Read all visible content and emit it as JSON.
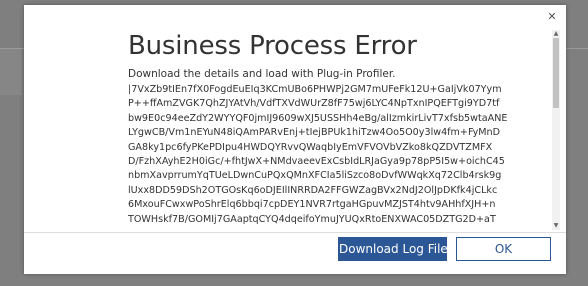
{
  "dialog": {
    "title": "Business Process Error",
    "subtitle": "Download the details and load with Plug-in Profiler.",
    "close_glyph": "✕",
    "log_lines": [
      "|7VxZb9tIEn7fX0FogdEuEIq3KCmUBo6PHWPj2GM7mUFeFk12U+GaIjVk07Yym",
      "P++ffAmZVGK7QhZJYAtVh/VdfTXVdWUrZ8fF75wj6LYC4NpTxnIPQEFTgi9YD7tf",
      "bw9E0c94eeZdY2WYYQF0jmIJ9609wXJ5USSHh4eBg/alIzmkirLivT7xfsb5wtaANE",
      "LYgwCB/Vm1nEYuN48iQAmPARvEnj+tIejBPUk1hiTzw4Oo5O0y3lw4fm+FyMnD",
      "GA8ky1pc6fyPKePDIpu4HWDQYRvvQWaqbIyEmVFVOVbVZko8kQZDVTZMFX",
      "D/FzhXAyhE2H0iGc/+fhtJwX+NMdvaeevExCsbIdLRJaGya9p78pP5I5w+oichC45",
      "nbmXavprrumYqTUeLDwnCuPQxQMnXFCIa5liSzco8oDvfWWqkXq72Clb4rsk9g",
      "lUxx8DD59DSh2OTGOsKq6oDJEIlINRRDA2FFGWZagBVx2NdJ2OlJpDKfk4jCLkc",
      "6MxouFCwxwPoShrElq6bbqi7cpDEY1NVR7rtgaHGpuvMZJST4htv9AHhfXJH+n",
      "TOWHskf7B/GOMIj7GAaptqCYQ4dqeifoYmuJYUQxRtoENXWAC05DZTG2D+aT"
    ],
    "buttons": {
      "download": "Download Log File",
      "ok": "OK"
    }
  }
}
